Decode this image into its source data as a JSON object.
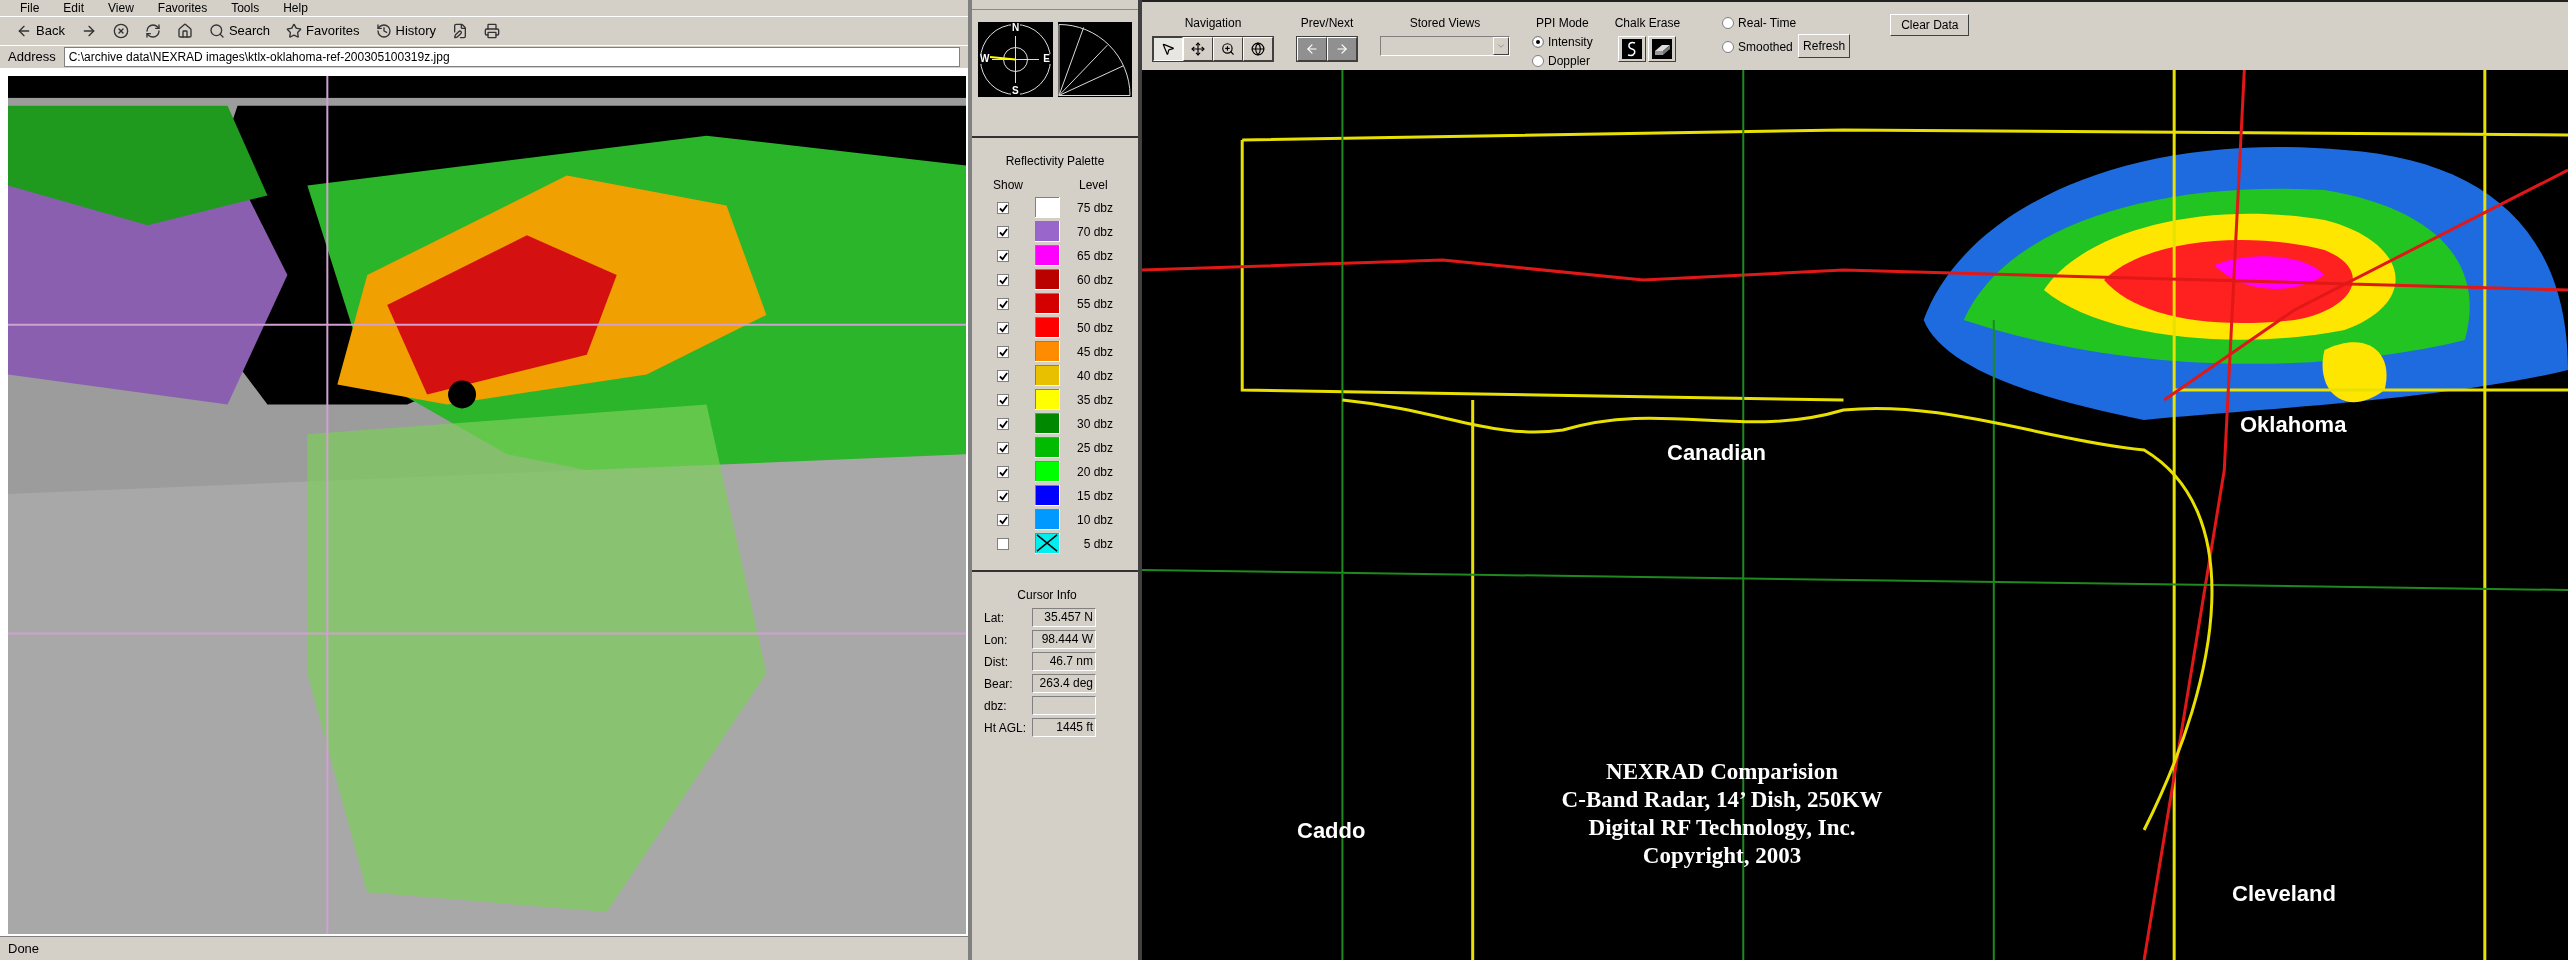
{
  "browser": {
    "menu": [
      "File",
      "Edit",
      "View",
      "Favorites",
      "Tools",
      "Help"
    ],
    "toolbar": [
      {
        "kind": "back",
        "label": "Back"
      },
      {
        "kind": "forward"
      },
      {
        "kind": "stop"
      },
      {
        "kind": "refresh"
      },
      {
        "kind": "home"
      },
      {
        "kind": "search",
        "label": "Search"
      },
      {
        "kind": "favorites",
        "label": "Favorites"
      },
      {
        "kind": "history",
        "label": "History"
      },
      {
        "kind": "edit"
      },
      {
        "kind": "print"
      }
    ],
    "address_label": "Address",
    "address": "C:\\archive data\\NEXRAD images\\ktlx-oklahoma-ref-200305100319z.jpg",
    "status": "Done"
  },
  "compass": {
    "north": "N",
    "south": "S",
    "east": "E",
    "west": "W"
  },
  "palette": {
    "title": "Reflectivity Palette",
    "show_header": "Show",
    "level_header": "Level",
    "levels": [
      {
        "label": "75 dbz",
        "color": "#ffffff",
        "checked": true
      },
      {
        "label": "70 dbz",
        "color": "#9966cc",
        "checked": true
      },
      {
        "label": "65 dbz",
        "color": "#ff00ff",
        "checked": true
      },
      {
        "label": "60 dbz",
        "color": "#bb0000",
        "checked": true
      },
      {
        "label": "55 dbz",
        "color": "#d40000",
        "checked": true
      },
      {
        "label": "50 dbz",
        "color": "#ff0000",
        "checked": true
      },
      {
        "label": "45 dbz",
        "color": "#ff8c00",
        "checked": true
      },
      {
        "label": "40 dbz",
        "color": "#e8c000",
        "checked": true
      },
      {
        "label": "35 dbz",
        "color": "#ffff00",
        "checked": true
      },
      {
        "label": "30 dbz",
        "color": "#008800",
        "checked": true
      },
      {
        "label": "25 dbz",
        "color": "#00bb00",
        "checked": true
      },
      {
        "label": "20 dbz",
        "color": "#00ff00",
        "checked": true
      },
      {
        "label": "15 dbz",
        "color": "#0000ff",
        "checked": true
      },
      {
        "label": "10 dbz",
        "color": "#0099ff",
        "checked": true
      },
      {
        "label": "5 dbz",
        "color": "#00eeee",
        "checked": false
      }
    ]
  },
  "cursor_info": {
    "title": "Cursor Info",
    "fields": [
      {
        "label": "Lat:",
        "value": "35.457 N"
      },
      {
        "label": "Lon:",
        "value": "98.444 W"
      },
      {
        "label": "Dist:",
        "value": "46.7 nm"
      },
      {
        "label": "Bear:",
        "value": "263.4 deg"
      },
      {
        "label": "dbz:"
      },
      {
        "label": "Ht AGL:",
        "value": "1445 ft"
      }
    ]
  },
  "toolbar": {
    "navigation": {
      "label": "Navigation",
      "tools": [
        {
          "kind": "pointer",
          "selected": true
        },
        {
          "kind": "pan",
          "selected": false
        },
        {
          "kind": "zoom",
          "selected": false
        },
        {
          "kind": "globe",
          "selected": false
        }
      ]
    },
    "prev_next": "Prev/Next",
    "stored_views": "Stored Views",
    "ppi": {
      "label": "PPI Mode",
      "options": [
        {
          "label": "Intensity",
          "selected": true
        },
        {
          "label": "Doppler",
          "selected": false
        }
      ]
    },
    "chalk_erase": "Chalk Erase",
    "data_mode": [
      {
        "label": "Real- Time",
        "selected": false
      },
      {
        "label": "Smoothed",
        "selected": false
      }
    ],
    "refresh": "Refresh",
    "clear": "Clear Data"
  },
  "map": {
    "counties": [
      "Canadian",
      "Oklahoma",
      "Caddo",
      "Cleveland"
    ],
    "caption": [
      "NEXRAD Comparision",
      "C-Band Radar, 14’ Dish, 250KW",
      "Digital RF Technology, Inc.",
      "Copyright, 2003"
    ]
  }
}
